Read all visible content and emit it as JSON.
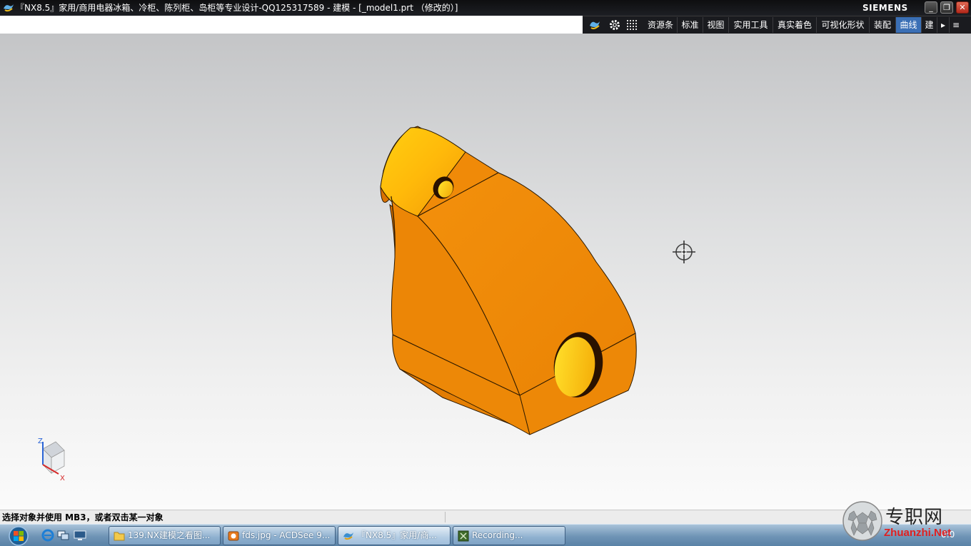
{
  "window": {
    "title": "『NX8.5』家用/商用电器冰箱、冷柜、陈列柜、岛柜等专业设计-QQ125317589 - 建模 - [_model1.prt （修改的）]",
    "brand": "SIEMENS",
    "minimize_label": "_",
    "restore_label": "❐",
    "close_label": "✕"
  },
  "toolbar": {
    "items": [
      {
        "label": "资源条"
      },
      {
        "label": "标准"
      },
      {
        "label": "视图"
      },
      {
        "label": "实用工具"
      },
      {
        "label": "真实着色"
      },
      {
        "label": "可视化形状"
      },
      {
        "label": "装配"
      },
      {
        "label": "曲线",
        "active": true
      },
      {
        "label": "建"
      }
    ],
    "overflow_label": "▸",
    "menu_label": "≡"
  },
  "triad": {
    "z_label": "Z",
    "x_label": "X",
    "z_color": "#2a64d6",
    "x_color": "#d62a2a"
  },
  "model": {
    "body_color": "#f28c0a",
    "highlight_color": "#ffd21c",
    "edge_color": "#2a1800"
  },
  "statusbar": {
    "prompt": "选择对象并使用 MB3，或者双击某一对象"
  },
  "taskbar": {
    "tasks": [
      {
        "label": "139.NX建模之看图..."
      },
      {
        "label": "fds.jpg - ACDSee 9..."
      },
      {
        "label": "『NX8.5』家用/商..."
      },
      {
        "label": "Recording..."
      }
    ],
    "clock": "0:0"
  },
  "watermark": {
    "text_cn": "专职网",
    "text_en": "Zhuanzhi.Net"
  }
}
